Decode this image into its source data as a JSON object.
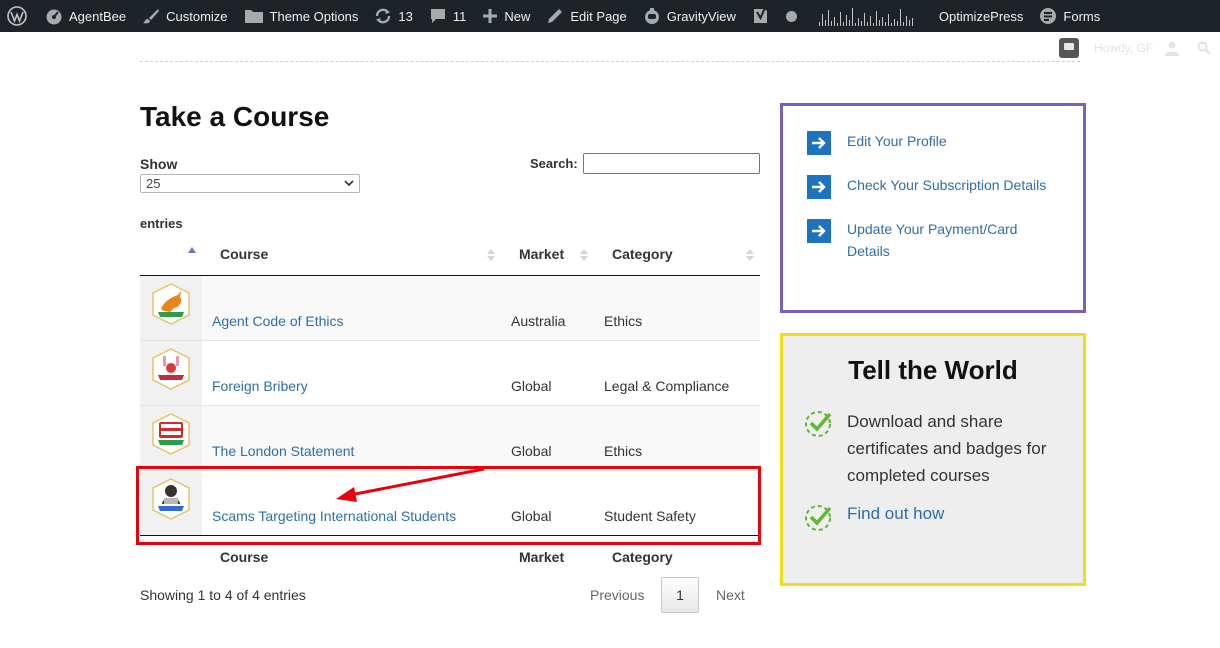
{
  "admin_bar": {
    "site_name": "AgentBee",
    "customize": "Customize",
    "theme_options": "Theme Options",
    "updates_count": "13",
    "comments_count": "11",
    "new": "New",
    "edit_page": "Edit Page",
    "gravityview": "GravityView",
    "optimizepress": "OptimizePress",
    "forms": "Forms"
  },
  "user_bar": {
    "howdy": "Howdy, GF"
  },
  "page": {
    "title": "Take a Course"
  },
  "table_controls": {
    "show_label": "Show",
    "show_value": "25",
    "entries_label": "entries",
    "search_label": "Search:",
    "search_value": ""
  },
  "table": {
    "headers": {
      "course": "Course",
      "market": "Market",
      "category": "Category"
    },
    "rows": [
      {
        "course": "Agent Code of Ethics",
        "market": "Australia",
        "category": "Ethics",
        "badge": "kangaroo-badge-icon"
      },
      {
        "course": "Foreign Bribery",
        "market": "Global",
        "category": "Legal & Compliance",
        "badge": "bribery-badge-icon"
      },
      {
        "course": "The London Statement",
        "market": "Global",
        "category": "Ethics",
        "badge": "london-bus-badge-icon"
      },
      {
        "course": "Scams Targeting International Students",
        "market": "Global",
        "category": "Student Safety",
        "badge": "hacker-badge-icon"
      }
    ],
    "info": "Showing 1 to 4 of 4 entries",
    "pagination": {
      "previous": "Previous",
      "current": "1",
      "next": "Next"
    }
  },
  "sidebar": {
    "account_links": [
      {
        "label": "Edit Your Profile"
      },
      {
        "label": "Check Your Subscription Details"
      },
      {
        "label": "Update Your Payment/Card Details"
      }
    ],
    "tell_world": {
      "title": "Tell the World",
      "text": "Download and share certificates and badges for completed courses",
      "link": "Find out how"
    }
  },
  "colors": {
    "admin_bar_bg": "#1d2327",
    "link_blue": "#2f6ea8",
    "arrow_box_blue": "#1e73be",
    "account_box_border": "#7a5fbf",
    "world_box_border": "#f2dd17",
    "annotation_red": "#e8000b",
    "check_green": "#5fb830"
  }
}
